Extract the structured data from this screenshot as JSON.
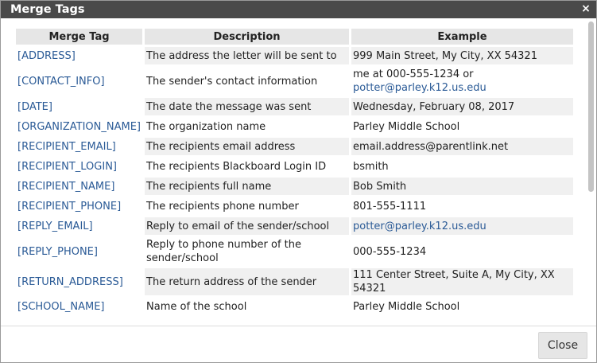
{
  "dialog": {
    "title": "Merge Tags",
    "close_icon": "×",
    "close_button_label": "Close"
  },
  "table": {
    "headers": [
      "Merge Tag",
      "Description",
      "Example"
    ],
    "rows": [
      {
        "tag": "[ADDRESS]",
        "description": "The address the letter will be sent to",
        "example": "999 Main Street, My City, XX 54321"
      },
      {
        "tag": "[CONTACT_INFO]",
        "description": "The sender's contact information",
        "example_line1": "me at 000-555-1234 or",
        "example_link": "potter@parley.k12.us.edu"
      },
      {
        "tag": "[DATE]",
        "description": "The date the message was sent",
        "example": "Wednesday, February 08, 2017"
      },
      {
        "tag": "[ORGANIZATION_NAME]",
        "description": "The organization name",
        "example": "Parley Middle School"
      },
      {
        "tag": "[RECIPIENT_EMAIL]",
        "description": "The recipients email address",
        "example": "email.address@parentlink.net"
      },
      {
        "tag": "[RECIPIENT_LOGIN]",
        "description": "The recipients Blackboard Login ID",
        "example": "bsmith"
      },
      {
        "tag": "[RECIPIENT_NAME]",
        "description": "The recipients full name",
        "example": "Bob Smith"
      },
      {
        "tag": "[RECIPIENT_PHONE]",
        "description": "The recipients phone number",
        "example": "801-555-1111"
      },
      {
        "tag": "[REPLY_EMAIL]",
        "description": "Reply to email of the sender/school",
        "example_link": "potter@parley.k12.us.edu"
      },
      {
        "tag": "[REPLY_PHONE]",
        "description": "Reply to phone number of the sender/school",
        "example": "000-555-1234"
      },
      {
        "tag": "[RETURN_ADDRESS]",
        "description": "The return address of the sender",
        "example": "111 Center Street, Suite A, My City, XX 54321"
      },
      {
        "tag": "[SCHOOL_NAME]",
        "description": "Name of the school",
        "example": "Parley Middle School"
      }
    ]
  },
  "colors": {
    "titlebar": "#4a4a4a",
    "link": "#2a5a96",
    "header_bg": "#e6e6e6",
    "row_bg": "#f0f0f0"
  },
  "icons": {
    "close": "close-icon"
  }
}
